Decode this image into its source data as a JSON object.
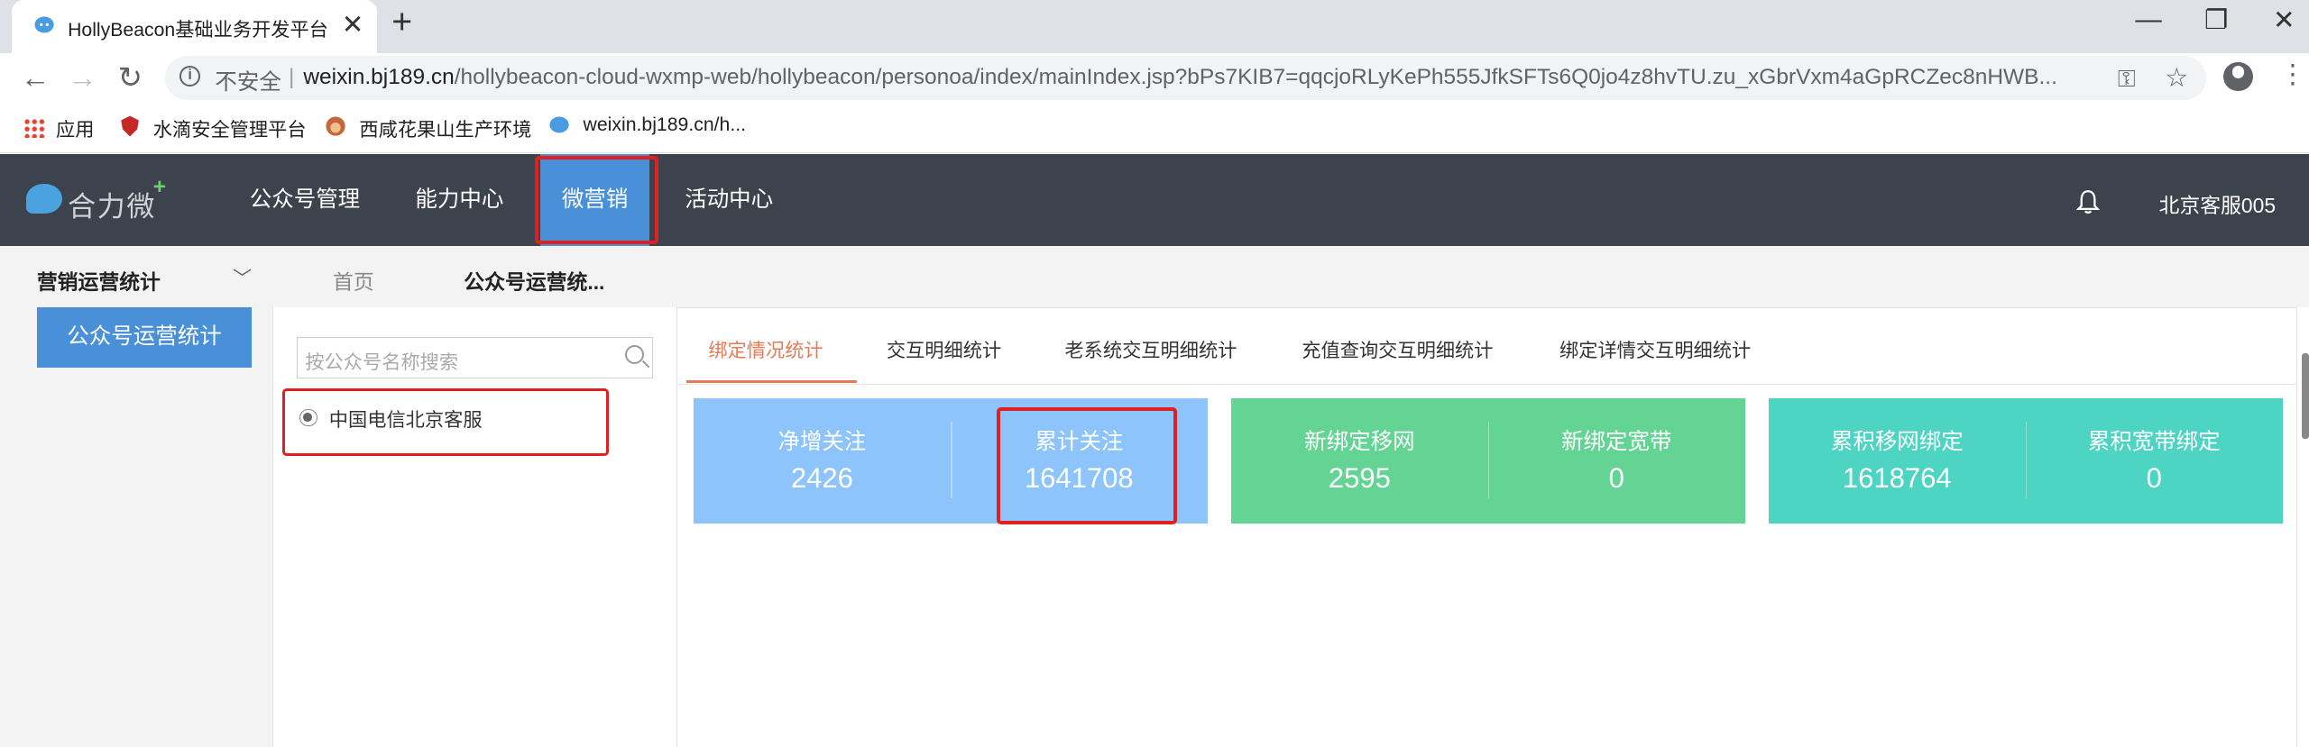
{
  "browser": {
    "tab_title": "HollyBeacon基础业务开发平台",
    "new_tab": "+",
    "close": "✕",
    "security_label": "不安全",
    "url_host": "weixin.bj189.cn",
    "url_path": "/hollybeacon-cloud-wxmp-web/hollybeacon/personoa/index/mainIndex.jsp?bPs7KIB7=qqcjoRLyKePh555JfkSFTs6Q0jo4z8hvTU.zu_xGbrVxm4aGpRCZec8nHWB...",
    "bookmarks": [
      {
        "label": "应用"
      },
      {
        "label": "水滴安全管理平台"
      },
      {
        "label": "西咸花果山生产环境"
      },
      {
        "label": "weixin.bj189.cn/h..."
      }
    ]
  },
  "header": {
    "logo_text": "合力微",
    "logo_plus": "+",
    "nav": [
      {
        "label": "公众号管理"
      },
      {
        "label": "能力中心"
      },
      {
        "label": "微营销"
      },
      {
        "label": "活动中心"
      }
    ],
    "user": "北京客服005"
  },
  "sidebar": {
    "title": "营销运营统计",
    "button": "公众号运营统计"
  },
  "breadcrumb": {
    "home": "首页",
    "current": "公众号运营统..."
  },
  "account_panel": {
    "search_placeholder": "按公众号名称搜索",
    "accounts": [
      {
        "name": "中国电信北京客服"
      }
    ]
  },
  "tabs": [
    {
      "label": "绑定情况统计"
    },
    {
      "label": "交互明细统计"
    },
    {
      "label": "老系统交互明细统计"
    },
    {
      "label": "充值查询交互明细统计"
    },
    {
      "label": "绑定详情交互明细统计"
    }
  ],
  "cards": [
    {
      "color": "#8dc4fb",
      "stats": [
        {
          "label": "净增关注",
          "value": "2426"
        },
        {
          "label": "累计关注",
          "value": "1641708"
        }
      ]
    },
    {
      "color": "#63d494",
      "stats": [
        {
          "label": "新绑定移网",
          "value": "2595"
        },
        {
          "label": "新绑定宽带",
          "value": "0"
        }
      ]
    },
    {
      "color": "#4dd4c2",
      "stats": [
        {
          "label": "累积移网绑定",
          "value": "1618764"
        },
        {
          "label": "累积宽带绑定",
          "value": "0"
        }
      ]
    }
  ]
}
